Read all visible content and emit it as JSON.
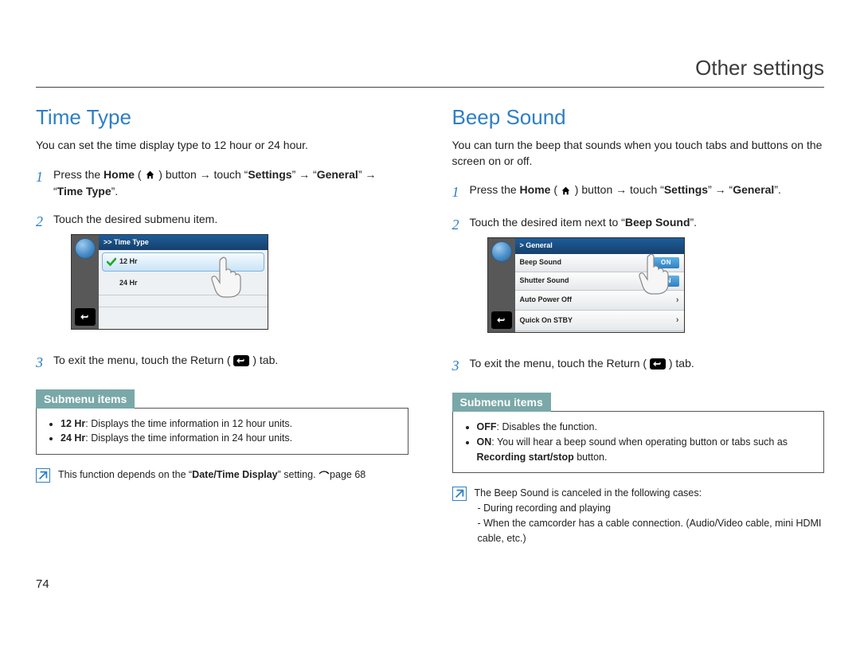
{
  "page": {
    "title": "Other settings",
    "number": "74"
  },
  "left": {
    "heading": "Time Type",
    "intro": "You can set the time display type to 12 hour or 24 hour.",
    "step1_a": "Press the ",
    "step1_home": "Home",
    "step1_b": " ( ",
    "step1_c": " ) button → touch “",
    "step1_settings": "Settings",
    "step1_d": "” → “",
    "step1_general": "General",
    "step1_e": "” → “",
    "step1_timetype": "Time Type",
    "step1_f": "”.",
    "step2": "Touch the desired submenu item.",
    "step3_a": "To exit the menu, touch the Return ( ",
    "step3_b": " ) tab.",
    "screenshot": {
      "header": ">> Time Type",
      "row1": "12 Hr",
      "row2": "24 Hr"
    },
    "submenu_label": "Submenu items",
    "sub_12_b": "12 Hr",
    "sub_12_t": ": Displays the time information in 12 hour units.",
    "sub_24_b": "24 Hr",
    "sub_24_t": ": Displays the time information in 24 hour units.",
    "note_a": "This function depends on the “",
    "note_b": "Date/Time Display",
    "note_c": "” setting. ",
    "note_ref": "page 68"
  },
  "right": {
    "heading": "Beep Sound",
    "intro": "You can turn the beep that sounds when you touch tabs and buttons on the screen on or off.",
    "step1_a": "Press the ",
    "step1_home": "Home",
    "step1_b": " ( ",
    "step1_c": " ) button → touch “",
    "step1_settings": "Settings",
    "step1_d": "” → “",
    "step1_general": "General",
    "step1_e": "”.",
    "step2_a": "Touch the desired item next to “",
    "step2_b": "Beep Sound",
    "step2_c": "”.",
    "step3_a": "To exit the menu, touch the Return ( ",
    "step3_b": " ) tab.",
    "screenshot": {
      "header": "> General",
      "r1": "Beep Sound",
      "r2": "Shutter Sound",
      "r3": "Auto Power Off",
      "r4": "Quick On STBY",
      "on": "ON"
    },
    "submenu_label": "Submenu items",
    "sub_off_b": "OFF",
    "sub_off_t": ": Disables the function.",
    "sub_on_b": "ON",
    "sub_on_t1": ": You will hear a beep sound when operating button or tabs such as ",
    "sub_on_t2": "Recording start/stop",
    "sub_on_t3": " button.",
    "note_1": "The Beep Sound is canceled in the following cases:",
    "note_2": "- During recording and playing",
    "note_3": "- When the camcorder has a cable connection. (Audio/Video cable, mini HDMI cable, etc.)"
  }
}
